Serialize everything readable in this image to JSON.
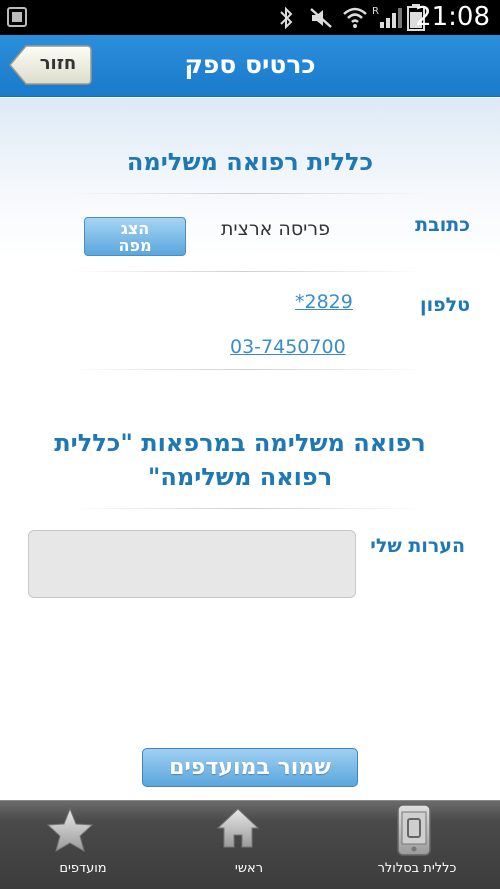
{
  "status_bar": {
    "time": "21:08"
  },
  "header": {
    "title": "כרטיס ספק",
    "back_label": "חזור"
  },
  "provider": {
    "name": "כללית רפואה משלימה"
  },
  "address": {
    "label": "כתובת",
    "value": "פריסה ארצית",
    "map_button_line1": "הצג",
    "map_button_line2": "מפה"
  },
  "phone": {
    "label": "טלפון",
    "numbers": [
      "*2829",
      "03-7450700"
    ]
  },
  "service": {
    "text": "רפואה משלימה במרפאות \"כללית רפואה משלימה\""
  },
  "notes": {
    "label": "הערות שלי",
    "value": ""
  },
  "actions": {
    "save_label": "שמור במועדפים"
  },
  "bottom_nav": {
    "items": [
      {
        "label": "מועדפים",
        "icon": "star-icon"
      },
      {
        "label": "ראשי",
        "icon": "home-icon"
      },
      {
        "label": "כללית בסלולר",
        "icon": "mobile-icon"
      }
    ]
  },
  "colors": {
    "header_blue": "#1f82d1",
    "title_blue": "#1e78b4",
    "link_blue": "#3b8dc8",
    "nav_dark": "#3c3c3c"
  }
}
